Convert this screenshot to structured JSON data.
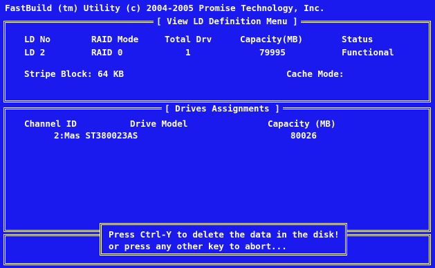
{
  "app_title": "FastBuild (tm) Utility (c) 2004-2005 Promise Technology, Inc.",
  "ld_menu": {
    "caption": "[ View LD Definition Menu ]",
    "headers": [
      "LD No",
      "RAID Mode",
      "Total Drv",
      "Capacity(MB)",
      "Status"
    ],
    "row": [
      "LD 2",
      "RAID 0",
      "1",
      "79995",
      "Functional"
    ],
    "stripe_block": "Stripe Block: 64 KB",
    "cache_mode": "Cache Mode:"
  },
  "drives": {
    "caption": "[ Drives Assignments ]",
    "headers": [
      "Channel ID",
      "Drive Model",
      "Capacity (MB)"
    ],
    "rows": [
      {
        "channel_model": "2:Mas ST380023AS",
        "capacity": "80026"
      }
    ]
  },
  "dialog": {
    "line1": "Press Ctrl-Y to delete the data in the disk!",
    "line2": "or press any other key to abort..."
  },
  "colors": {
    "background": "#1a1aee",
    "text": "#ffffff"
  }
}
